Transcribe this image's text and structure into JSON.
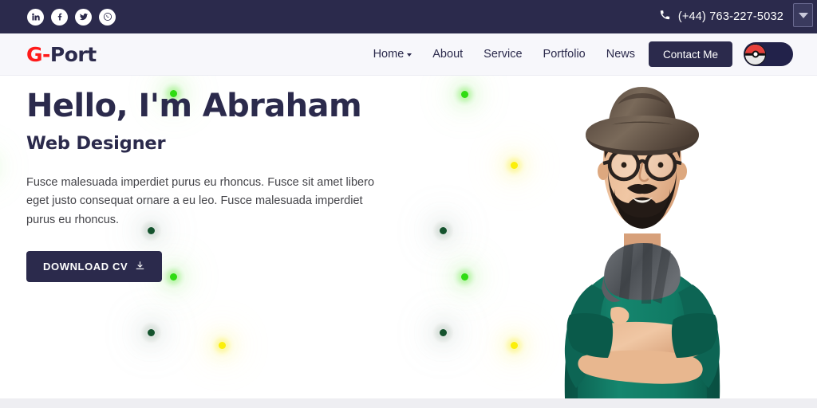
{
  "topbar": {
    "social": [
      {
        "name": "linkedin-icon",
        "label": "LinkedIn"
      },
      {
        "name": "facebook-icon",
        "label": "Facebook"
      },
      {
        "name": "twitter-icon",
        "label": "Twitter"
      },
      {
        "name": "whatsapp-icon",
        "label": "WhatsApp"
      }
    ],
    "phone_icon": "phone-icon",
    "phone": "(+44) 763-227-5032",
    "corner_chip_icon": "chevron-down-icon",
    "bg_color": "#2b2a4c"
  },
  "header": {
    "logo": {
      "accent": "G-",
      "rest": "Port",
      "accent_color": "#ff1a1a",
      "rest_color": "#2b2a4c"
    },
    "nav": [
      {
        "label": "Home",
        "has_chevron": true
      },
      {
        "label": "About",
        "has_chevron": false
      },
      {
        "label": "Service",
        "has_chevron": false
      },
      {
        "label": "Portfolio",
        "has_chevron": false
      },
      {
        "label": "News",
        "has_chevron": false
      }
    ],
    "contact_button": "Contact Me",
    "avatar_icon": "pokeball-icon",
    "bg_color": "#f7f7fb"
  },
  "hero": {
    "title": "Hello, I'm Abraham",
    "subtitle": "Web Designer",
    "description": "Fusce malesuada imperdiet purus eu rhoncus. Fusce sit amet libero eget justo consequat ornare a eu leo. Fusce malesuada imperdiet purus eu rhoncus.",
    "cv_button": "DOWNLOAD CV",
    "cv_button_icon": "download-icon",
    "portrait_alt": "bearded man with hat glasses scarf and green sweater",
    "accent_colors": {
      "bright_green": "#2fdc12",
      "dark_green": "#14532d",
      "yellow": "#fbef0a",
      "navy": "#2b2a4c"
    }
  }
}
